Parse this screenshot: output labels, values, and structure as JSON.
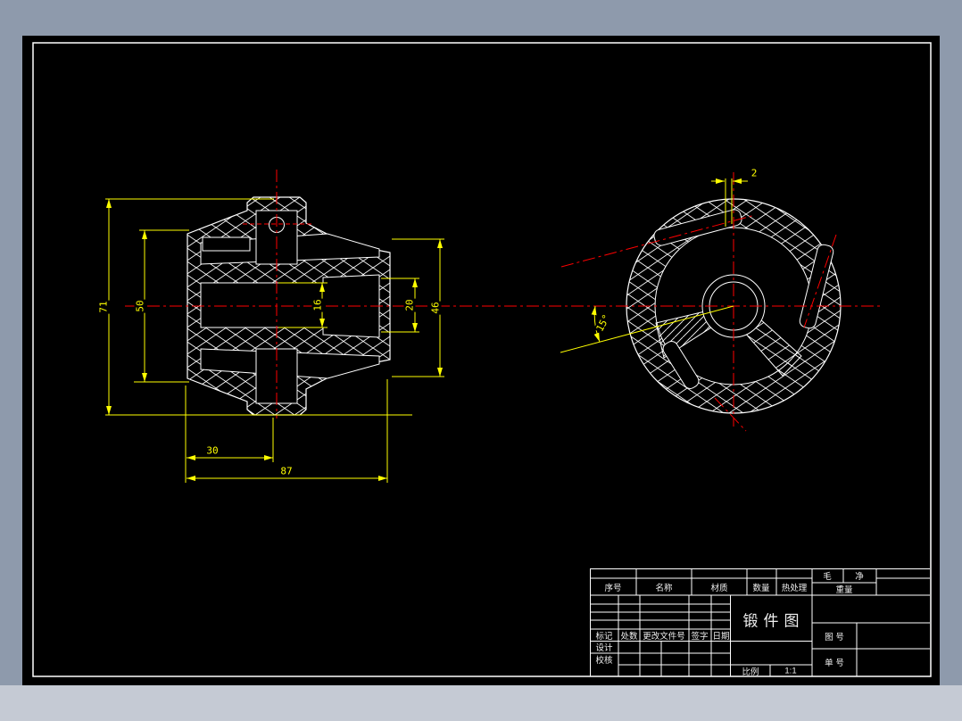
{
  "window": {
    "chrome_color": "#8e9aac",
    "statusbar_color": "#c5cad4",
    "canvas_color": "#000000"
  },
  "colors": {
    "outline": "#ffffff",
    "dimension": "#ffff00",
    "centerline": "#ff0000"
  },
  "drawing": {
    "section_view": {
      "dim_overall_height": "71",
      "dim_flange_height": "50",
      "dim_bore": "16",
      "dim_bore_right": "20",
      "dim_right_face": "46",
      "dim_length_step": "30",
      "dim_length_overall": "87"
    },
    "end_view": {
      "dim_wall": "2",
      "dim_angle": "15°"
    }
  },
  "title_block": {
    "header": {
      "serial": "序号",
      "name": "名称",
      "material": "材质",
      "qty": "数量",
      "heat_treat": "热处理",
      "weight_gross": "毛",
      "weight_net": "净",
      "weight": "重量"
    },
    "revision": {
      "mark": "标记",
      "count": "处数",
      "change_doc": "更改文件号",
      "signature": "签字",
      "date": "日期"
    },
    "roles": {
      "design": "设计",
      "check": "校核"
    },
    "drawing_title": "锻件图",
    "scale_label": "比例",
    "scale_value": "1:1",
    "drawing_no_label": "图 号",
    "sheet_no_label": "单 号"
  }
}
